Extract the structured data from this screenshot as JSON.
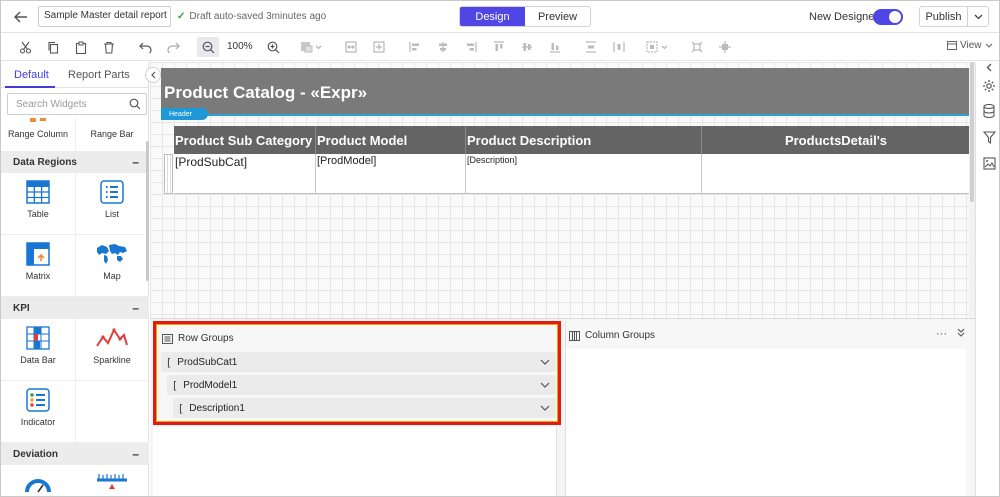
{
  "topbar": {
    "report_name": "Sample Master detail report lis",
    "autosave": "Draft auto-saved 3minutes ago",
    "mode_design": "Design",
    "mode_preview": "Preview",
    "new_designer": "New Designer",
    "publish": "Publish"
  },
  "toolbar": {
    "zoom": "100%",
    "view": "View"
  },
  "left": {
    "tab_default": "Default",
    "tab_parts": "Report Parts",
    "search_placeholder": "Search Widgets",
    "top_items": [
      "Range Column",
      "Range Bar"
    ],
    "cat_data_regions": "Data Regions",
    "data_regions": [
      "Table",
      "List",
      "Matrix",
      "Map"
    ],
    "cat_kpi": "KPI",
    "kpi": [
      "Data Bar",
      "Sparkline",
      "Indicator"
    ],
    "cat_deviation": "Deviation"
  },
  "surface": {
    "title": "Product Catalog - «Expr»",
    "header_tag": "Header",
    "columns": [
      "Product Sub Category",
      "Product Model",
      "Product Description",
      "ProductsDetail's"
    ],
    "cells": [
      "[ProdSubCat]",
      "[ProdModel]",
      "[Description]",
      ""
    ]
  },
  "groups": {
    "row_title": "Row Groups",
    "row_items": [
      "ProdSubCat1",
      "ProdModel1",
      "Description1"
    ],
    "col_title": "Column Groups"
  },
  "colors": {
    "accent": "#5046e5",
    "header_band": "#7a7a7a",
    "table_header": "#646464",
    "highlight": "#e01b12"
  }
}
